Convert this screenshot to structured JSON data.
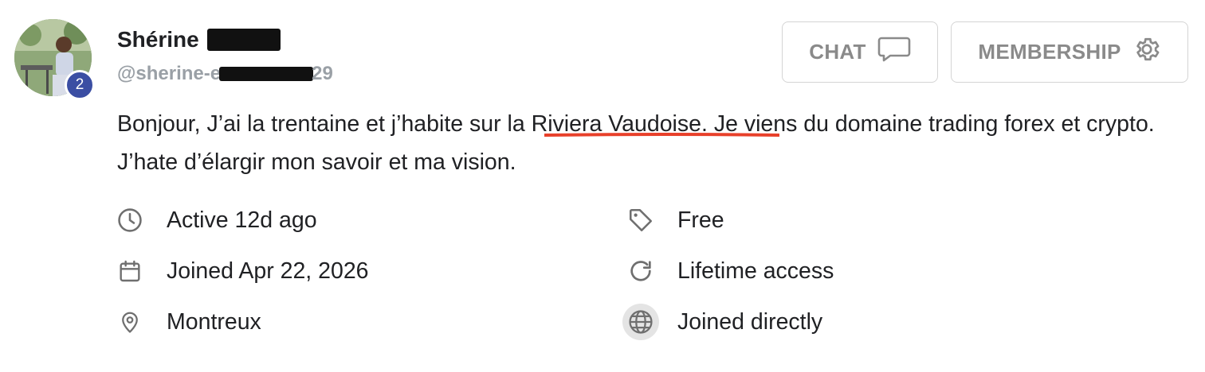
{
  "profile": {
    "name": "Shérine",
    "handle_visible_start": "@sherine-e",
    "handle_visible_end": "29",
    "level": "2",
    "bio_before": "Bonjour, J’ai la trentaine et j’habite sur ",
    "bio_highlight": "la Riviera Vaudoise.",
    "bio_after": " Je viens du domaine trading forex et crypto. J’hate d’élargir mon savoir et ma vision."
  },
  "actions": {
    "chat_label": "CHAT",
    "membership_label": "MEMBERSHIP"
  },
  "details_left": [
    {
      "icon": "clock-icon",
      "text": "Active 12d ago"
    },
    {
      "icon": "calendar-icon",
      "text": "Joined Apr 22, 2026"
    },
    {
      "icon": "location-pin-icon",
      "text": "Montreux"
    }
  ],
  "details_right": [
    {
      "icon": "tag-icon",
      "text": "Free"
    },
    {
      "icon": "refresh-icon",
      "text": "Lifetime access"
    },
    {
      "icon": "globe-icon",
      "text": "Joined directly"
    }
  ],
  "colors": {
    "badge": "#3b4ea3",
    "underline": "#e8402a",
    "muted": "#9aa0a6"
  }
}
